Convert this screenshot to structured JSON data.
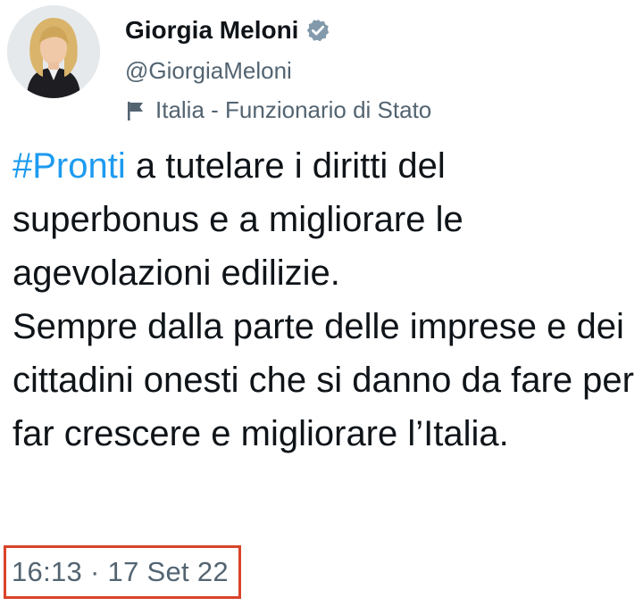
{
  "author": {
    "name": "Giorgia Meloni",
    "handle": "@GiorgiaMeloni",
    "label": "Italia - Funzionario di Stato",
    "avatar_icon": "profile-photo",
    "verified_icon": "verified-badge-icon",
    "flag_icon": "government-flag-icon"
  },
  "tweet": {
    "hashtag": "#Pronti",
    "text_line_1_rest": " a tutelare i diritti del superbonus e a migliorare le agevolazioni edilizie.",
    "text_line_2": "Sempre dalla parte delle imprese e dei cittadini onesti che si danno da fare per far crescere e migliorare l’Italia.",
    "timestamp": "16:13 · 17 Set 22"
  },
  "colors": {
    "hashtag": "#1d9bf0",
    "secondary_text": "#536471",
    "highlight_box": "#d9432a"
  }
}
